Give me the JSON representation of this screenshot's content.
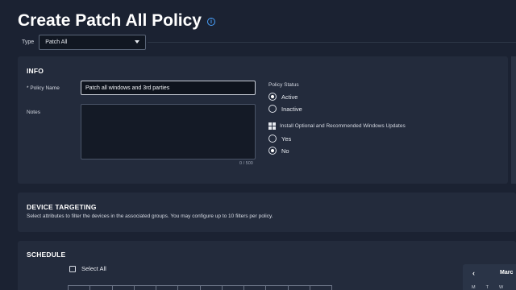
{
  "page": {
    "title": "Create Patch All Policy"
  },
  "type_field": {
    "label": "Type",
    "value": "Patch All"
  },
  "info": {
    "title": "INFO",
    "policy_name_label": "* Policy Name",
    "policy_name_value": "Patch all windows and 3rd parties",
    "notes_label": "Notes",
    "notes_value": "",
    "notes_count": "0 / 500",
    "policy_status_label": "Policy Status",
    "status_options": [
      {
        "label": "Active",
        "selected": true
      },
      {
        "label": "Inactive",
        "selected": false
      }
    ],
    "windows_updates_label": "Install Optional and Recommended Windows Updates",
    "windows_updates_options": [
      {
        "label": "Yes",
        "selected": false
      },
      {
        "label": "No",
        "selected": true
      }
    ]
  },
  "device_targeting": {
    "title": "DEVICE TARGETING",
    "description": "Select attributes to filter the devices in the associated groups. You may configure up to 10 filters per policy."
  },
  "schedule": {
    "title": "SCHEDULE",
    "select_all_label": "Select All",
    "select_all_checked": false,
    "calendar": {
      "prev": "‹",
      "month": "Marc",
      "days": [
        "M",
        "T",
        "W"
      ]
    }
  },
  "colors": {
    "background": "#1b2232",
    "panel": "#232b3c",
    "accent": "#4aa3ff"
  }
}
